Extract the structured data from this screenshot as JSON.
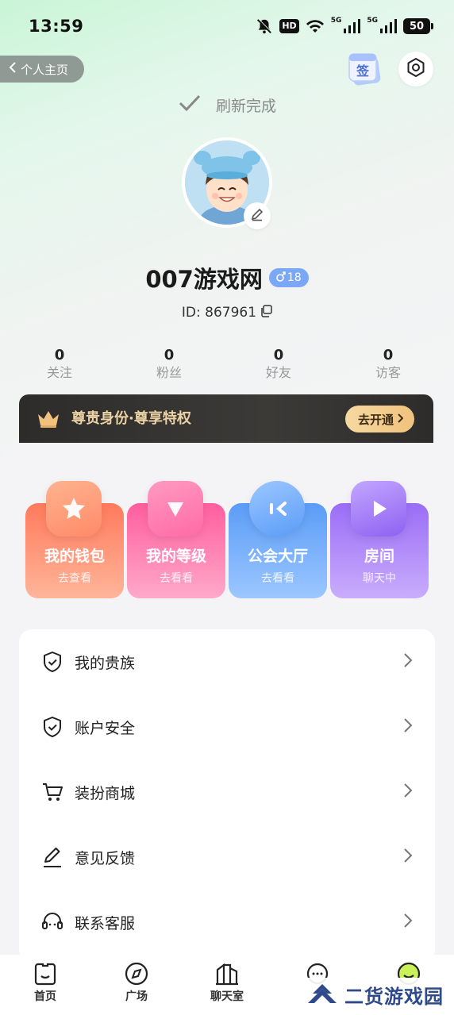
{
  "status_bar": {
    "time": "13:59",
    "battery": "50",
    "hd": "HD"
  },
  "header": {
    "back_label": "个人主页",
    "sign_icon_char": "签"
  },
  "refresh": {
    "text": "刷新完成"
  },
  "profile": {
    "username": "007游戏网",
    "gender_age": "18",
    "id_text": "ID: 867961"
  },
  "stats": [
    {
      "value": "0",
      "label": "关注"
    },
    {
      "value": "0",
      "label": "粉丝"
    },
    {
      "value": "0",
      "label": "好友"
    },
    {
      "value": "0",
      "label": "访客"
    }
  ],
  "vip": {
    "text": "尊贵身份·尊享特权",
    "button": "去开通"
  },
  "tiles": [
    {
      "title": "我的钱包",
      "sub": "去查看"
    },
    {
      "title": "我的等级",
      "sub": "去看看"
    },
    {
      "title": "公会大厅",
      "sub": "去看看"
    },
    {
      "title": "房间",
      "sub": "聊天中"
    }
  ],
  "menu": [
    {
      "label": "我的贵族",
      "icon": "shield-check-icon"
    },
    {
      "label": "账户安全",
      "icon": "shield-check-icon"
    },
    {
      "label": "装扮商城",
      "icon": "cart-icon"
    },
    {
      "label": "意见反馈",
      "icon": "pencil-icon"
    },
    {
      "label": "联系客服",
      "icon": "headset-icon"
    }
  ],
  "tabs": [
    {
      "label": "首页",
      "icon": "home-icon"
    },
    {
      "label": "广场",
      "icon": "compass-icon"
    },
    {
      "label": "聊天室",
      "icon": "building-icon"
    },
    {
      "label": "",
      "icon": "message-icon"
    },
    {
      "label": "",
      "icon": "me-icon"
    }
  ],
  "watermark": {
    "text": "二货游戏园"
  },
  "colors": {
    "vip_gold": "#ecd2a4",
    "gender_blue": "#7aa8f7",
    "wallet": "#ff7a5c",
    "level": "#ff5e9e",
    "guild": "#5b9cf7",
    "room": "#9a6df6"
  }
}
